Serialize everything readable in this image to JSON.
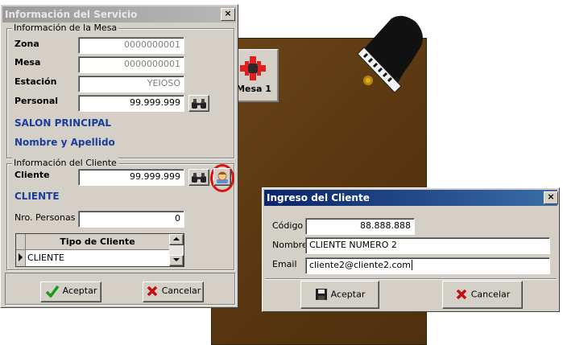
{
  "background": {
    "table_button_label": "Mesa 1"
  },
  "service_window": {
    "title": "Información del Servicio",
    "table_group": {
      "legend": "Información de la Mesa",
      "zona_label": "Zona",
      "zona_value": "0000000001",
      "mesa_label": "Mesa",
      "mesa_value": "0000000001",
      "estacion_label": "Estación",
      "estacion_value": "YEIOSO",
      "personal_label": "Personal",
      "personal_value": "99.999.999",
      "salon_text": "SALON PRINCIPAL",
      "nombre_text": "Nombre y Apellido"
    },
    "client_group": {
      "legend": "Información del Cliente",
      "cliente_label": "Cliente",
      "cliente_value": "99.999.999",
      "cliente_text": "CLIENTE",
      "personas_label": "Nro. Personas",
      "personas_value": "0",
      "grid_header": "Tipo de Cliente",
      "grid_row": "CLIENTE"
    },
    "accept_label": "Aceptar",
    "cancel_label": "Cancelar"
  },
  "client_window": {
    "title": "Ingreso del Cliente",
    "codigo_label": "Código",
    "codigo_value": "88.888.888",
    "nombre_label": "Nombre",
    "nombre_value": "CLIENTE NUMERO 2",
    "email_label": "Email",
    "email_value": "cliente2@cliente2.com",
    "accept_label": "Aceptar",
    "cancel_label": "Cancelar"
  },
  "colors": {
    "active_title": "#0a246a",
    "label_blue": "#1a3e9a",
    "highlight_circle": "#e01010"
  },
  "icons": [
    "close-icon",
    "binoculars-icon",
    "client-avatar-icon",
    "checkmark-icon",
    "x-icon",
    "save-icon",
    "piano-icon",
    "table-icon"
  ]
}
